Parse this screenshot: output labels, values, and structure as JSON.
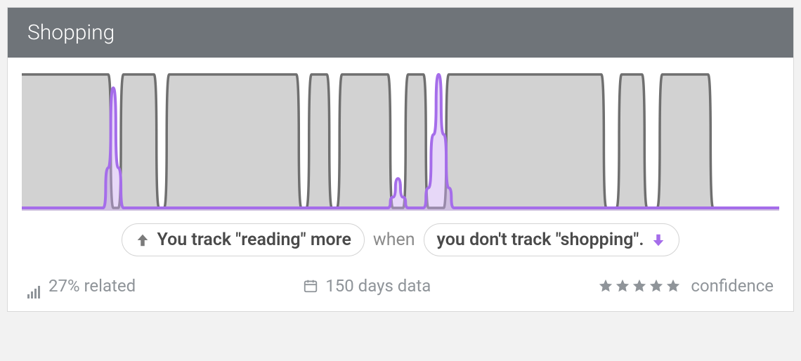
{
  "header": {
    "title": "Shopping"
  },
  "correlation": {
    "left_pill_text": "You track \"reading\" more",
    "joiner": "when",
    "right_pill_text": "you don't track \"shopping\".",
    "left_arrow_direction": "up",
    "right_arrow_direction": "down"
  },
  "stats": {
    "related": "27% related",
    "days": "150 days data",
    "confidence_label": "confidence",
    "confidence_stars": 5
  },
  "colors": {
    "grey_series": "#6f6f6f",
    "grey_fill": "#d2d2d2",
    "purple_series": "#a56dea",
    "purple_fill": "#c9a9f0",
    "star_fill": "#8f9499",
    "arrow_grey": "#7b7b7b"
  },
  "chart_data": {
    "type": "area",
    "n": 150,
    "x": [
      0,
      1,
      2,
      3,
      4,
      5,
      6,
      7,
      8,
      9,
      10,
      11,
      12,
      13,
      14,
      15,
      16,
      17,
      18,
      19,
      20,
      21,
      22,
      23,
      24,
      25,
      26,
      27,
      28,
      29,
      30,
      31,
      32,
      33,
      34,
      35,
      36,
      37,
      38,
      39,
      40,
      41,
      42,
      43,
      44,
      45,
      46,
      47,
      48,
      49,
      50,
      51,
      52,
      53,
      54,
      55,
      56,
      57,
      58,
      59,
      60,
      61,
      62,
      63,
      64,
      65,
      66,
      67,
      68,
      69,
      70,
      71,
      72,
      73,
      74,
      75,
      76,
      77,
      78,
      79,
      80,
      81,
      82,
      83,
      84,
      85,
      86,
      87,
      88,
      89,
      90,
      91,
      92,
      93,
      94,
      95,
      96,
      97,
      98,
      99,
      100,
      101,
      102,
      103,
      104,
      105,
      106,
      107,
      108,
      109,
      110,
      111,
      112,
      113,
      114,
      115,
      116,
      117,
      118,
      119,
      120,
      121,
      122,
      123,
      124,
      125,
      126,
      127,
      128,
      129,
      130,
      131,
      132,
      133,
      134,
      135,
      136,
      137,
      138,
      139,
      140,
      141,
      142,
      143,
      144,
      145,
      146,
      147,
      148,
      149
    ],
    "series": [
      {
        "name": "shopping",
        "color_key": "grey_series",
        "fill_key": "grey_fill",
        "values": [
          1,
          1,
          1,
          1,
          1,
          1,
          1,
          1,
          1,
          1,
          1,
          1,
          1,
          1,
          1,
          1,
          1,
          1,
          0,
          0,
          1,
          1,
          1,
          1,
          1,
          1,
          1,
          0,
          0,
          1,
          1,
          1,
          1,
          1,
          1,
          1,
          1,
          1,
          1,
          1,
          1,
          1,
          1,
          1,
          1,
          1,
          1,
          1,
          1,
          1,
          1,
          1,
          1,
          1,
          1,
          0,
          0,
          1,
          1,
          1,
          1,
          0,
          0,
          1,
          1,
          1,
          1,
          1,
          1,
          1,
          1,
          1,
          1,
          0,
          0,
          0,
          1,
          1,
          1,
          1,
          0,
          0,
          0,
          0,
          1,
          1,
          1,
          1,
          1,
          1,
          1,
          1,
          1,
          1,
          1,
          1,
          1,
          1,
          1,
          1,
          1,
          1,
          1,
          1,
          1,
          1,
          1,
          1,
          1,
          1,
          1,
          1,
          1,
          1,
          1,
          0,
          0,
          0,
          1,
          1,
          1,
          1,
          1,
          0,
          0,
          0,
          1,
          1,
          1,
          1,
          1,
          1,
          1,
          1,
          1,
          1,
          0,
          0,
          0,
          0,
          0,
          0,
          0,
          0,
          0,
          0,
          0,
          0,
          0,
          0
        ]
      },
      {
        "name": "reading",
        "color_key": "purple_series",
        "fill_key": "purple_fill",
        "values": [
          0,
          0,
          0,
          0,
          0,
          0,
          0,
          0,
          0,
          0,
          0,
          0,
          0,
          0,
          0,
          0,
          0,
          0.3,
          0.9,
          0.3,
          0,
          0,
          0,
          0,
          0,
          0,
          0,
          0,
          0,
          0,
          0,
          0,
          0,
          0,
          0,
          0,
          0,
          0,
          0,
          0,
          0,
          0,
          0,
          0,
          0,
          0,
          0,
          0,
          0,
          0,
          0,
          0,
          0,
          0,
          0,
          0,
          0,
          0,
          0,
          0,
          0,
          0,
          0,
          0,
          0,
          0,
          0,
          0,
          0,
          0,
          0,
          0,
          0,
          0.08,
          0.22,
          0.08,
          0,
          0,
          0,
          0,
          0.15,
          0.55,
          1.0,
          0.55,
          0.15,
          0,
          0,
          0,
          0,
          0,
          0,
          0,
          0,
          0,
          0,
          0,
          0,
          0,
          0,
          0,
          0,
          0,
          0,
          0,
          0,
          0,
          0,
          0,
          0,
          0,
          0,
          0,
          0,
          0,
          0,
          0,
          0,
          0,
          0,
          0,
          0,
          0,
          0,
          0,
          0,
          0,
          0,
          0,
          0,
          0,
          0,
          0,
          0,
          0,
          0,
          0,
          0,
          0,
          0,
          0,
          0,
          0,
          0,
          0,
          0,
          0,
          0,
          0,
          0,
          0
        ]
      }
    ],
    "ylim": [
      0,
      1
    ],
    "title": "",
    "xlabel": "",
    "ylabel": ""
  }
}
